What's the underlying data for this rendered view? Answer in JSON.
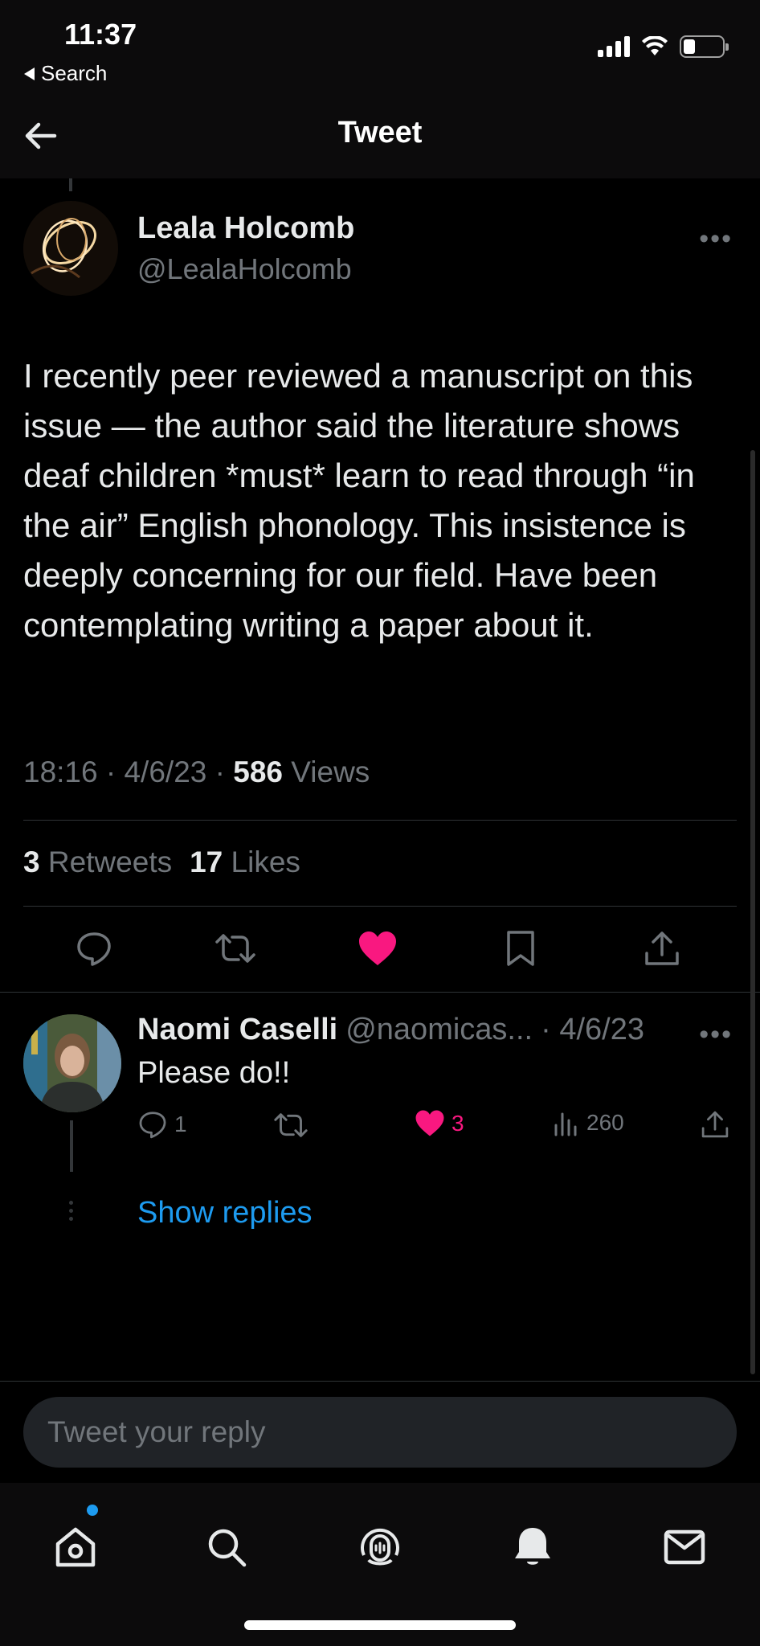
{
  "status_bar": {
    "time": "11:37",
    "back_app": "Search"
  },
  "header": {
    "title": "Tweet"
  },
  "tweet": {
    "author_name": "Leala Holcomb",
    "author_handle": "@LealaHolcomb",
    "text": "I recently peer reviewed a manuscript on this issue — the author said the literature shows deaf children *must* learn to read through “in the air” English phonology. This insistence is deeply concerning for our field. Have been contemplating writing a paper about it.",
    "time": "18:16",
    "date": "4/6/23",
    "views_count": "586",
    "views_label": "Views",
    "retweets_count": "3",
    "retweets_label": "Retweets",
    "likes_count": "17",
    "likes_label": "Likes"
  },
  "reply": {
    "name": "Naomi Caselli",
    "handle": "@naomicas...",
    "date": "· 4/6/23",
    "text": "Please do!!",
    "reply_count": "1",
    "like_count": "3",
    "views": "260",
    "show_replies": "Show replies"
  },
  "composer": {
    "placeholder": "Tweet your reply"
  },
  "colors": {
    "accent": "#1d9bf0",
    "like": "#f91880",
    "muted": "#71767b",
    "background": "#000000"
  },
  "icons": [
    "back-arrow-icon",
    "more-icon",
    "reply-icon",
    "retweet-icon",
    "heart-icon",
    "bookmark-icon",
    "share-icon",
    "views-icon",
    "home-icon",
    "search-icon",
    "spaces-icon",
    "bell-icon",
    "mail-icon"
  ]
}
